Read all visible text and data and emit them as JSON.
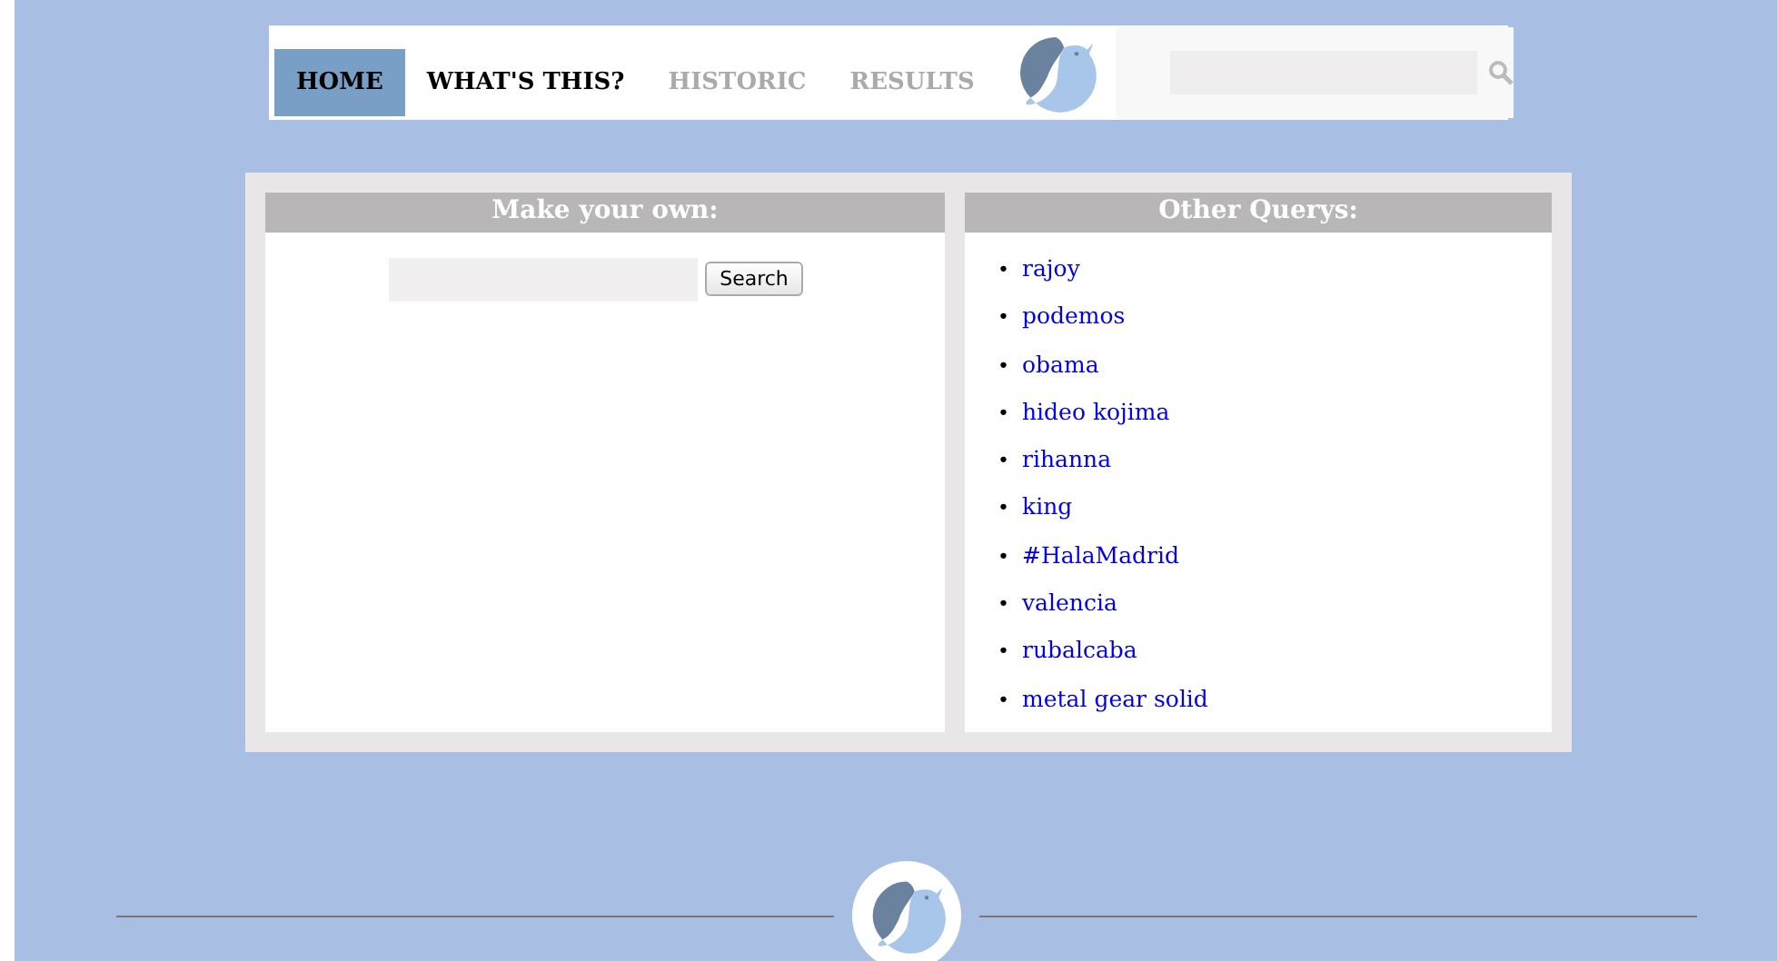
{
  "nav": {
    "items": [
      {
        "label": "HOME",
        "selected": true,
        "disabled": false
      },
      {
        "label": "WHAT'S THIS?",
        "selected": false,
        "disabled": false
      },
      {
        "label": "HISTORIC",
        "selected": false,
        "disabled": true
      },
      {
        "label": "RESULTS",
        "selected": false,
        "disabled": true
      }
    ]
  },
  "make_your_own": {
    "title": "Make your own:",
    "button": "Search"
  },
  "other_queries": {
    "title": "Other Querys:",
    "items": [
      {
        "bullet": "•",
        "label": "rajoy"
      },
      {
        "bullet": "•",
        "label": "podemos"
      },
      {
        "bullet": "•",
        "label": "obama"
      },
      {
        "bullet": "•",
        "label": "hideo kojima"
      },
      {
        "bullet": "•",
        "label": "rihanna"
      },
      {
        "bullet": "•",
        "label": "king"
      },
      {
        "bullet": "•",
        "label": "#HalaMadrid"
      },
      {
        "bullet": "•",
        "label": "valencia"
      },
      {
        "bullet": "•",
        "label": "rubalcaba"
      },
      {
        "bullet": "•",
        "label": "metal gear solid"
      }
    ]
  }
}
